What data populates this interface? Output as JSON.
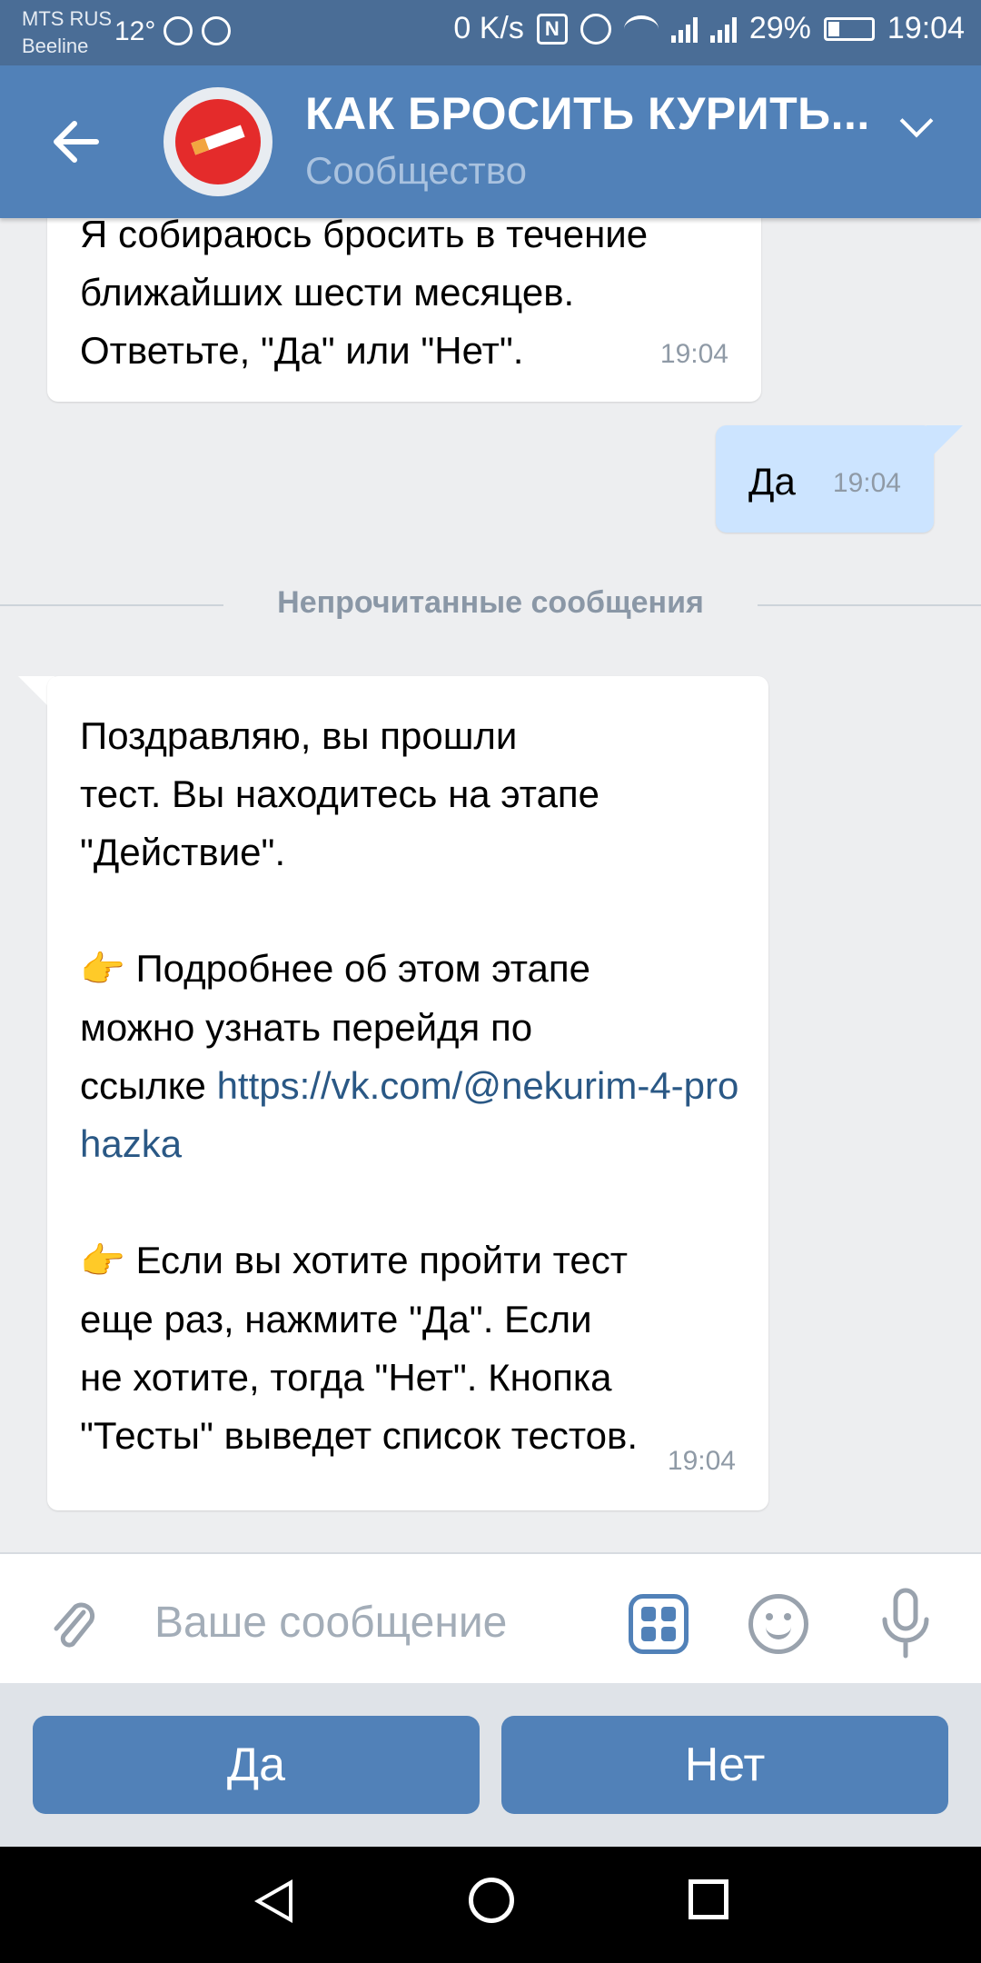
{
  "status_bar": {
    "carrier_1": "MTS RUS",
    "carrier_2": "Beeline",
    "temperature": "12°",
    "network_speed": "0 K/s",
    "battery": "29%",
    "time": "19:04"
  },
  "header": {
    "title": "КАК БРОСИТЬ КУРИТЬ...",
    "subtitle": "Сообщество"
  },
  "messages": [
    {
      "direction": "incoming",
      "text": "Я собираюсь бросить в течение\nближайших шести месяцев.\nОтветьте, \"Да\" или \"Нет\".",
      "time": "19:04"
    },
    {
      "direction": "outgoing",
      "text": "Да",
      "time": "19:04"
    },
    {
      "direction": "incoming",
      "text_1": "Поздравляю, вы прошли\nтест. Вы находитесь на этапе\n\"Действие\".",
      "text_2_prefix": "Подробнее об этом этапе\nможно узнать перейдя по\nссылке ",
      "link": "https://vk.com/@nekurim-4-prohazka",
      "text_3": "Если вы хотите пройти тест\nеще раз, нажмите \"Да\". Если\nне хотите, тогда \"Нет\". Кнопка\n\"Тесты\" выведет список тестов.",
      "time": "19:04"
    }
  ],
  "unread_divider": "Непрочитанные сообщения",
  "composer": {
    "placeholder": "Ваше сообщение"
  },
  "bot_keyboard": {
    "yes": "Да",
    "no": "Нет"
  },
  "colors": {
    "header": "#5181b8",
    "status_bar": "#4a6d96",
    "outgoing_bubble": "#cce4ff",
    "link": "#2a5885"
  },
  "icons": {
    "point": "👉"
  }
}
